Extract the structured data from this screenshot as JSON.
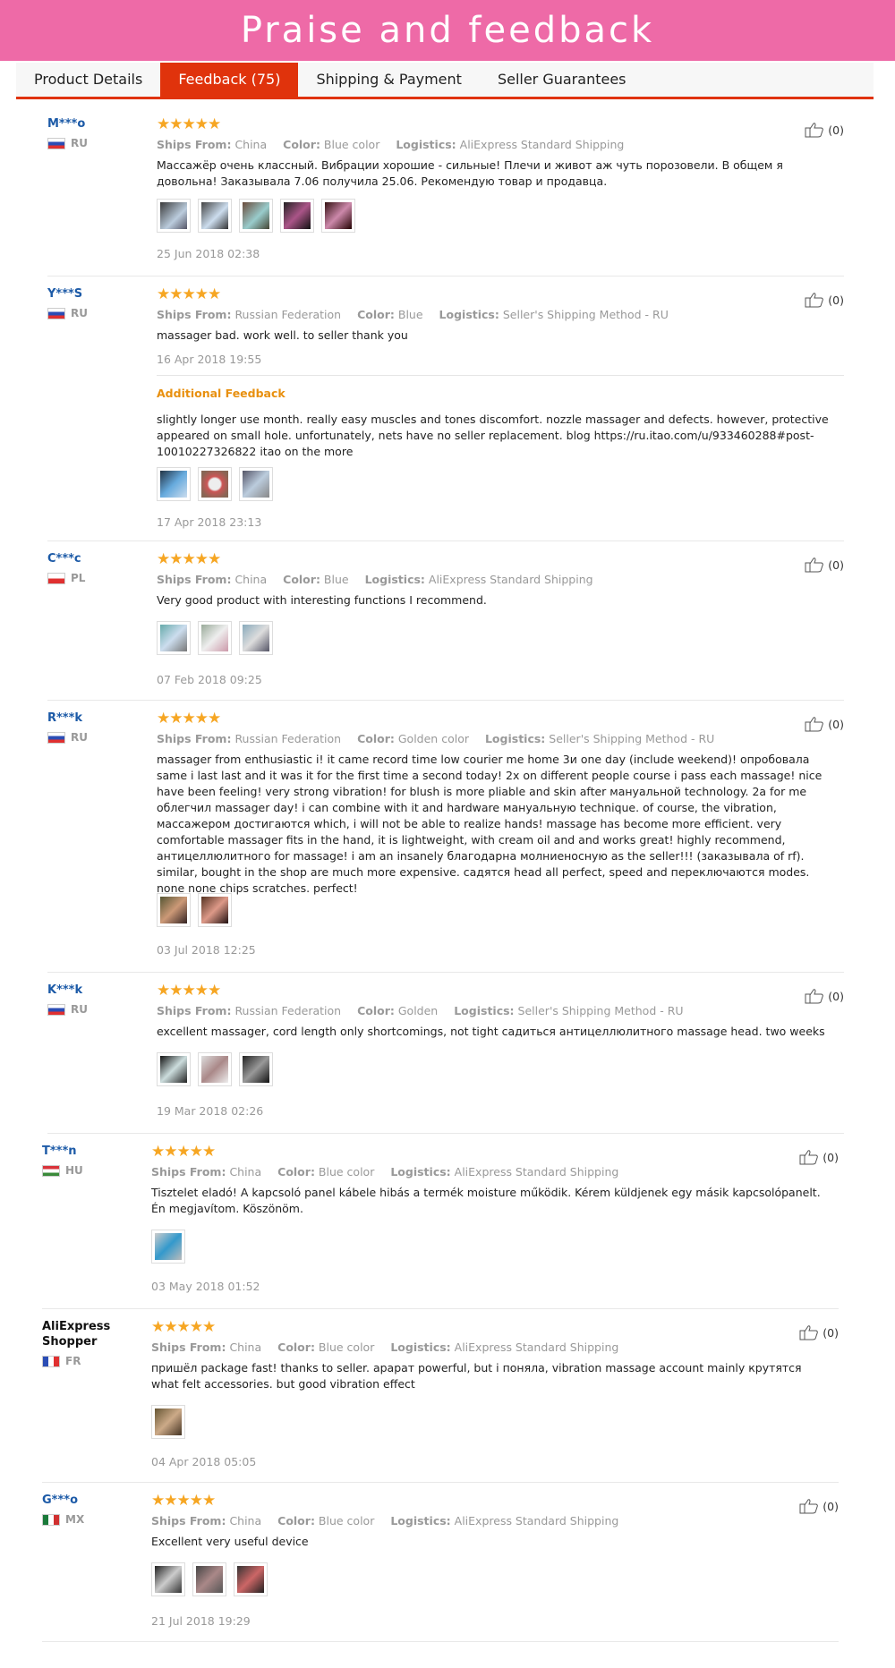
{
  "banner": {
    "title": "Praise and feedback"
  },
  "tabs": [
    "Product Details",
    "Feedback (75)",
    "Shipping & Payment",
    "Seller Guarantees"
  ],
  "labels": {
    "ships_from": "Ships From:",
    "color": "Color:",
    "logistics": "Logistics:",
    "additional_feedback": "Additional Feedback"
  },
  "stars": "★★★★★",
  "reviews": [
    {
      "user": "M***o",
      "country": "RU",
      "ships_from": "China",
      "color": "Blue color",
      "logistics": "AliExpress Standard Shipping",
      "text": "Массажёр очень классный. Вибрации хорошие - сильные! Плечи и живот аж чуть порозовели. В общем я довольна! Заказывала 7.06 получила 25.06. Рекомендую товар и продавца.",
      "date": "25 Jun 2018 02:38",
      "likes": "(0)"
    },
    {
      "user": "Y***S",
      "country": "RU",
      "ships_from": "Russian Federation",
      "color": "Blue",
      "logistics": "Seller's Shipping Method - RU",
      "text": "massager bad. work well. to seller thank you",
      "date": "16 Apr 2018 19:55",
      "additional_text": "slightly longer use month. really easy muscles and tones discomfort. nozzle massager and defects. however, protective appeared on small hole. unfortunately, nets have no seller replacement. blog https://ru.itao.com/u/933460288#post-10010227326822 itao on the more",
      "additional_date": "17 Apr 2018 23:13",
      "likes": "(0)"
    },
    {
      "user": "C***c",
      "country": "PL",
      "ships_from": "China",
      "color": "Blue",
      "logistics": "AliExpress Standard Shipping",
      "text": "Very good product with interesting functions I recommend.",
      "date": "07 Feb 2018 09:25",
      "likes": "(0)"
    },
    {
      "user": "R***k",
      "country": "RU",
      "ships_from": "Russian Federation",
      "color": "Golden color",
      "logistics": "Seller's Shipping Method - RU",
      "text": "massager from enthusiastic i! it came record time low courier me home 3и one day (include weekend)! опробовала same i last last and it was it for the first time a second today! 2x on different people course i pass each massage! nice have been feeling! very strong vibration! for blush is more pliable and skin after мануальной technology. 2а for me облегчил massager day! i can combine with it and hardware мануальную technique. of course, the vibration, массажером достигаются which, i will not be able to realize hands! massage has become more efficient. very comfortable massager fits in the hand, it is lightweight, with cream oil and and works great! highly recommend, антицеллюлитного for massage! i am an insanely благодарна молниеносную as the seller!!! (заказывала of rf). similar, bought in the shop are much more expensive. садятся head all perfect, speed and переключаются modes. none none chips scratches. perfect!",
      "date": "03 Jul 2018 12:25",
      "likes": "(0)"
    },
    {
      "user": "K***k",
      "country": "RU",
      "ships_from": "Russian Federation",
      "color": "Golden",
      "logistics": "Seller's Shipping Method - RU",
      "text": "excellent massager, cord length only shortcomings, not tight садиться антицеллюлитного massage head. two weeks",
      "date": "19 Mar 2018 02:26",
      "likes": "(0)"
    },
    {
      "user": "T***n",
      "country": "HU",
      "ships_from": "China",
      "color": "Blue color",
      "logistics": "AliExpress Standard Shipping",
      "text": "Tisztelet eladó! A kapcsoló panel kábele hibás a termék moisture működik. Kérem küldjenek egy másik kapcsolópanelt. Én megjavítom. Köszönöm.",
      "date": "03 May 2018 01:52",
      "likes": "(0)"
    },
    {
      "user": "AliExpress Shopper",
      "country": "FR",
      "ships_from": "China",
      "color": "Blue color",
      "logistics": "AliExpress Standard Shipping",
      "text": "пришёл package fast! thanks to seller. арарат powerful, but i поняла, vibration massage account mainly крутятся what felt accessories. but good vibration effect",
      "date": "04 Apr 2018 05:05",
      "likes": "(0)"
    },
    {
      "user": "G***o",
      "country": "MX",
      "ships_from": "China",
      "color": "Blue color",
      "logistics": "AliExpress Standard Shipping",
      "text": "Excellent very useful device",
      "date": "21 Jul 2018 19:29",
      "likes": "(0)"
    }
  ]
}
